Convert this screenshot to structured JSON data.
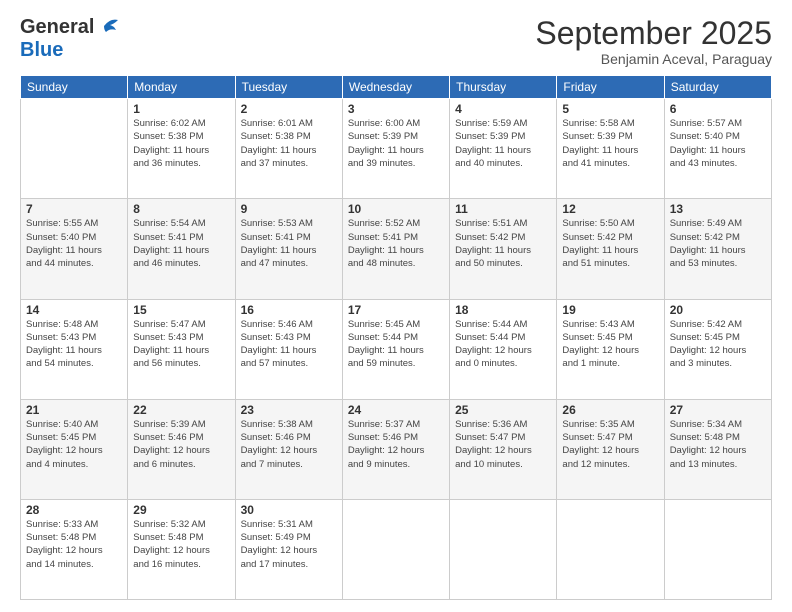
{
  "header": {
    "logo_general": "General",
    "logo_blue": "Blue",
    "title": "September 2025",
    "location": "Benjamin Aceval, Paraguay"
  },
  "days_of_week": [
    "Sunday",
    "Monday",
    "Tuesday",
    "Wednesday",
    "Thursday",
    "Friday",
    "Saturday"
  ],
  "weeks": [
    [
      {
        "day": "",
        "info": ""
      },
      {
        "day": "1",
        "info": "Sunrise: 6:02 AM\nSunset: 5:38 PM\nDaylight: 11 hours\nand 36 minutes."
      },
      {
        "day": "2",
        "info": "Sunrise: 6:01 AM\nSunset: 5:38 PM\nDaylight: 11 hours\nand 37 minutes."
      },
      {
        "day": "3",
        "info": "Sunrise: 6:00 AM\nSunset: 5:39 PM\nDaylight: 11 hours\nand 39 minutes."
      },
      {
        "day": "4",
        "info": "Sunrise: 5:59 AM\nSunset: 5:39 PM\nDaylight: 11 hours\nand 40 minutes."
      },
      {
        "day": "5",
        "info": "Sunrise: 5:58 AM\nSunset: 5:39 PM\nDaylight: 11 hours\nand 41 minutes."
      },
      {
        "day": "6",
        "info": "Sunrise: 5:57 AM\nSunset: 5:40 PM\nDaylight: 11 hours\nand 43 minutes."
      }
    ],
    [
      {
        "day": "7",
        "info": "Sunrise: 5:55 AM\nSunset: 5:40 PM\nDaylight: 11 hours\nand 44 minutes."
      },
      {
        "day": "8",
        "info": "Sunrise: 5:54 AM\nSunset: 5:41 PM\nDaylight: 11 hours\nand 46 minutes."
      },
      {
        "day": "9",
        "info": "Sunrise: 5:53 AM\nSunset: 5:41 PM\nDaylight: 11 hours\nand 47 minutes."
      },
      {
        "day": "10",
        "info": "Sunrise: 5:52 AM\nSunset: 5:41 PM\nDaylight: 11 hours\nand 48 minutes."
      },
      {
        "day": "11",
        "info": "Sunrise: 5:51 AM\nSunset: 5:42 PM\nDaylight: 11 hours\nand 50 minutes."
      },
      {
        "day": "12",
        "info": "Sunrise: 5:50 AM\nSunset: 5:42 PM\nDaylight: 11 hours\nand 51 minutes."
      },
      {
        "day": "13",
        "info": "Sunrise: 5:49 AM\nSunset: 5:42 PM\nDaylight: 11 hours\nand 53 minutes."
      }
    ],
    [
      {
        "day": "14",
        "info": "Sunrise: 5:48 AM\nSunset: 5:43 PM\nDaylight: 11 hours\nand 54 minutes."
      },
      {
        "day": "15",
        "info": "Sunrise: 5:47 AM\nSunset: 5:43 PM\nDaylight: 11 hours\nand 56 minutes."
      },
      {
        "day": "16",
        "info": "Sunrise: 5:46 AM\nSunset: 5:43 PM\nDaylight: 11 hours\nand 57 minutes."
      },
      {
        "day": "17",
        "info": "Sunrise: 5:45 AM\nSunset: 5:44 PM\nDaylight: 11 hours\nand 59 minutes."
      },
      {
        "day": "18",
        "info": "Sunrise: 5:44 AM\nSunset: 5:44 PM\nDaylight: 12 hours\nand 0 minutes."
      },
      {
        "day": "19",
        "info": "Sunrise: 5:43 AM\nSunset: 5:45 PM\nDaylight: 12 hours\nand 1 minute."
      },
      {
        "day": "20",
        "info": "Sunrise: 5:42 AM\nSunset: 5:45 PM\nDaylight: 12 hours\nand 3 minutes."
      }
    ],
    [
      {
        "day": "21",
        "info": "Sunrise: 5:40 AM\nSunset: 5:45 PM\nDaylight: 12 hours\nand 4 minutes."
      },
      {
        "day": "22",
        "info": "Sunrise: 5:39 AM\nSunset: 5:46 PM\nDaylight: 12 hours\nand 6 minutes."
      },
      {
        "day": "23",
        "info": "Sunrise: 5:38 AM\nSunset: 5:46 PM\nDaylight: 12 hours\nand 7 minutes."
      },
      {
        "day": "24",
        "info": "Sunrise: 5:37 AM\nSunset: 5:46 PM\nDaylight: 12 hours\nand 9 minutes."
      },
      {
        "day": "25",
        "info": "Sunrise: 5:36 AM\nSunset: 5:47 PM\nDaylight: 12 hours\nand 10 minutes."
      },
      {
        "day": "26",
        "info": "Sunrise: 5:35 AM\nSunset: 5:47 PM\nDaylight: 12 hours\nand 12 minutes."
      },
      {
        "day": "27",
        "info": "Sunrise: 5:34 AM\nSunset: 5:48 PM\nDaylight: 12 hours\nand 13 minutes."
      }
    ],
    [
      {
        "day": "28",
        "info": "Sunrise: 5:33 AM\nSunset: 5:48 PM\nDaylight: 12 hours\nand 14 minutes."
      },
      {
        "day": "29",
        "info": "Sunrise: 5:32 AM\nSunset: 5:48 PM\nDaylight: 12 hours\nand 16 minutes."
      },
      {
        "day": "30",
        "info": "Sunrise: 5:31 AM\nSunset: 5:49 PM\nDaylight: 12 hours\nand 17 minutes."
      },
      {
        "day": "",
        "info": ""
      },
      {
        "day": "",
        "info": ""
      },
      {
        "day": "",
        "info": ""
      },
      {
        "day": "",
        "info": ""
      }
    ]
  ]
}
